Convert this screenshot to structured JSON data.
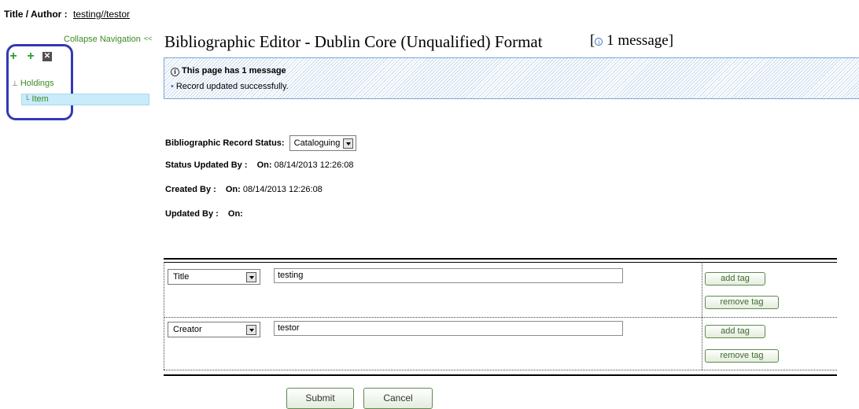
{
  "header": {
    "title_author_label": "Title / Author :",
    "title_author_value": "testing//testor"
  },
  "navigation": {
    "collapse_label": "Collapse Navigation",
    "collapse_arrow": "<<",
    "toolbar_icons": [
      "add-green-plus-icon",
      "add-green-plus-icon",
      "delete-x-icon"
    ],
    "tree": {
      "root_label": "Holdings",
      "child_label": "Item"
    }
  },
  "page": {
    "title": "Bibliographic Editor - Dublin Core (Unqualified) Format",
    "message_link_prefix": "[",
    "message_link_text": "1 message",
    "message_link_suffix": "]"
  },
  "message_box": {
    "heading": "This page has 1 message",
    "items": [
      "Record updated successfully."
    ]
  },
  "status": {
    "record_status_label": "Bibliographic Record Status:",
    "record_status_value": "Cataloguing",
    "status_updated_by_label": "Status Updated By :",
    "status_updated_on_label": "On:",
    "status_updated_on_value": "08/14/2013 12:26:08",
    "created_by_label": "Created By :",
    "created_on_label": "On:",
    "created_on_value": "08/14/2013 12:26:08",
    "updated_by_label": "Updated By :",
    "updated_on_label": "On:"
  },
  "tags": [
    {
      "element": "Title",
      "value": "testing",
      "add_label": "add tag",
      "remove_label": "remove tag"
    },
    {
      "element": "Creator",
      "value": "testor",
      "add_label": "add tag",
      "remove_label": "remove tag"
    }
  ],
  "actions": {
    "submit_label": "Submit",
    "cancel_label": "Cancel"
  },
  "colors": {
    "nav_green": "#3d8a25",
    "highlight_border": "#3438b5",
    "selected_item_bg": "#c9ecfa",
    "message_border": "#7ba6d4"
  }
}
